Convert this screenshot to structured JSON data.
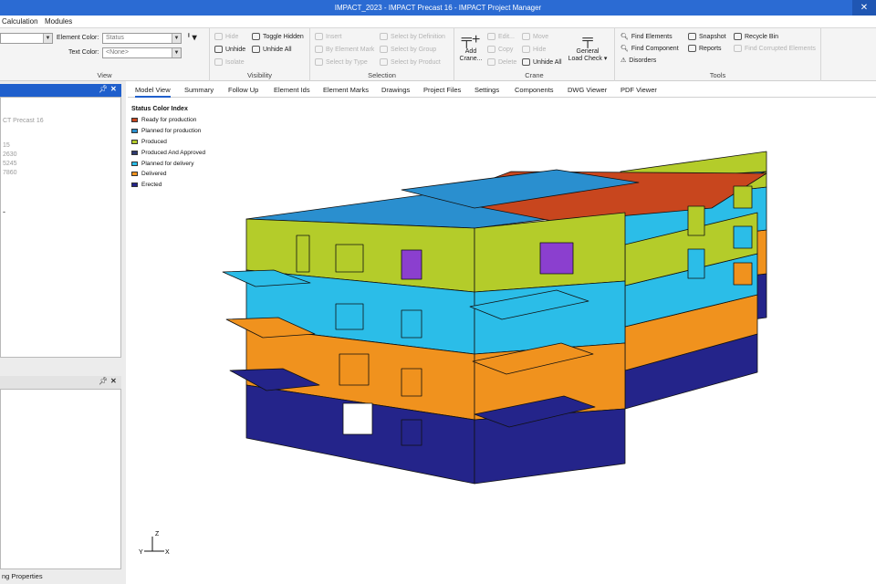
{
  "window": {
    "title": "IMPACT_2023 - IMPACT Precast 16 - IMPACT Project Manager"
  },
  "menu": [
    "Calculation",
    "Modules"
  ],
  "ribbon": {
    "view": {
      "name": "View",
      "element_color_label": "Element Color:",
      "element_color_value": "Status",
      "text_color_label": "Text Color:",
      "text_color_value": "<None>"
    },
    "visibility": {
      "name": "Visibility",
      "hide": "Hide",
      "unhide": "Unhide",
      "isolate": "Isolate",
      "toggle_hidden": "Toggle Hidden",
      "unhide_all": "Unhide All"
    },
    "selection": {
      "name": "Selection",
      "insert": "Insert",
      "by_element_mark": "By Element Mark",
      "select_by_type": "Select by Type",
      "select_by_definition": "Select by Definition",
      "select_by_group": "Select by Group",
      "select_by_product": "Select by Product"
    },
    "crane": {
      "name": "Crane",
      "add_crane_l1": "Add",
      "add_crane_l2": "Crane...",
      "edit": "Edit...",
      "copy": "Copy",
      "delete": "Delete",
      "move": "Move",
      "hide": "Hide",
      "unhide_all": "Unhide All",
      "general_l1": "General",
      "general_l2": "Load Check"
    },
    "tools": {
      "name": "Tools",
      "find_elements": "Find Elements",
      "find_component": "Find Component",
      "disorders": "Disorders",
      "snapshot": "Snapshot",
      "reports": "Reports",
      "recycle_bin": "Recycle Bin",
      "find_corrupted": "Find Corrupted Elements"
    }
  },
  "left_panel": {
    "partial_lines": [
      "CT Precast 16",
      "15",
      "2630",
      "5245",
      "7860"
    ],
    "bottom_label": "ng Properties"
  },
  "tabs": [
    "Model View",
    "Summary",
    "Follow Up",
    "Element Ids",
    "Element Marks",
    "Drawings",
    "Project Files",
    "Settings",
    "Components",
    "DWG Viewer",
    "PDF Viewer"
  ],
  "legend": {
    "title": "Status Color Index",
    "items": [
      {
        "label": "Ready for production",
        "color": "#c8461e"
      },
      {
        "label": "Planned for production",
        "color": "#2a8fcf"
      },
      {
        "label": "Produced",
        "color": "#b4cc2a"
      },
      {
        "label": "Produced And Approved",
        "color": "#2e3a70"
      },
      {
        "label": "Planned for delivery",
        "color": "#2bbde8"
      },
      {
        "label": "Delivered",
        "color": "#f0921e"
      },
      {
        "label": "Erected",
        "color": "#24248a"
      }
    ]
  },
  "axes": {
    "x": "X",
    "y": "Y",
    "z": "Z"
  }
}
